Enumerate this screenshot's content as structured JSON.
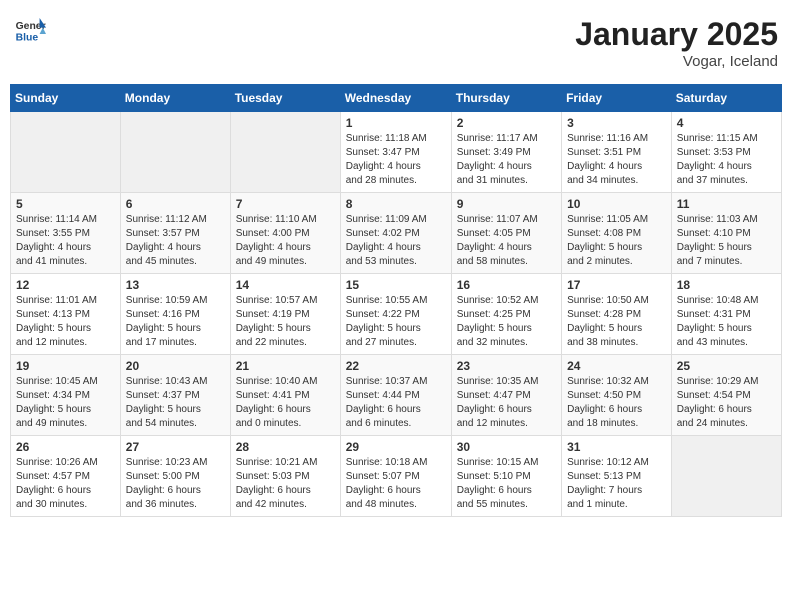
{
  "header": {
    "logo_general": "General",
    "logo_blue": "Blue",
    "title": "January 2025",
    "subtitle": "Vogar, Iceland"
  },
  "weekdays": [
    "Sunday",
    "Monday",
    "Tuesday",
    "Wednesday",
    "Thursday",
    "Friday",
    "Saturday"
  ],
  "weeks": [
    [
      {
        "day": "",
        "info": ""
      },
      {
        "day": "",
        "info": ""
      },
      {
        "day": "",
        "info": ""
      },
      {
        "day": "1",
        "info": "Sunrise: 11:18 AM\nSunset: 3:47 PM\nDaylight: 4 hours\nand 28 minutes."
      },
      {
        "day": "2",
        "info": "Sunrise: 11:17 AM\nSunset: 3:49 PM\nDaylight: 4 hours\nand 31 minutes."
      },
      {
        "day": "3",
        "info": "Sunrise: 11:16 AM\nSunset: 3:51 PM\nDaylight: 4 hours\nand 34 minutes."
      },
      {
        "day": "4",
        "info": "Sunrise: 11:15 AM\nSunset: 3:53 PM\nDaylight: 4 hours\nand 37 minutes."
      }
    ],
    [
      {
        "day": "5",
        "info": "Sunrise: 11:14 AM\nSunset: 3:55 PM\nDaylight: 4 hours\nand 41 minutes."
      },
      {
        "day": "6",
        "info": "Sunrise: 11:12 AM\nSunset: 3:57 PM\nDaylight: 4 hours\nand 45 minutes."
      },
      {
        "day": "7",
        "info": "Sunrise: 11:10 AM\nSunset: 4:00 PM\nDaylight: 4 hours\nand 49 minutes."
      },
      {
        "day": "8",
        "info": "Sunrise: 11:09 AM\nSunset: 4:02 PM\nDaylight: 4 hours\nand 53 minutes."
      },
      {
        "day": "9",
        "info": "Sunrise: 11:07 AM\nSunset: 4:05 PM\nDaylight: 4 hours\nand 58 minutes."
      },
      {
        "day": "10",
        "info": "Sunrise: 11:05 AM\nSunset: 4:08 PM\nDaylight: 5 hours\nand 2 minutes."
      },
      {
        "day": "11",
        "info": "Sunrise: 11:03 AM\nSunset: 4:10 PM\nDaylight: 5 hours\nand 7 minutes."
      }
    ],
    [
      {
        "day": "12",
        "info": "Sunrise: 11:01 AM\nSunset: 4:13 PM\nDaylight: 5 hours\nand 12 minutes."
      },
      {
        "day": "13",
        "info": "Sunrise: 10:59 AM\nSunset: 4:16 PM\nDaylight: 5 hours\nand 17 minutes."
      },
      {
        "day": "14",
        "info": "Sunrise: 10:57 AM\nSunset: 4:19 PM\nDaylight: 5 hours\nand 22 minutes."
      },
      {
        "day": "15",
        "info": "Sunrise: 10:55 AM\nSunset: 4:22 PM\nDaylight: 5 hours\nand 27 minutes."
      },
      {
        "day": "16",
        "info": "Sunrise: 10:52 AM\nSunset: 4:25 PM\nDaylight: 5 hours\nand 32 minutes."
      },
      {
        "day": "17",
        "info": "Sunrise: 10:50 AM\nSunset: 4:28 PM\nDaylight: 5 hours\nand 38 minutes."
      },
      {
        "day": "18",
        "info": "Sunrise: 10:48 AM\nSunset: 4:31 PM\nDaylight: 5 hours\nand 43 minutes."
      }
    ],
    [
      {
        "day": "19",
        "info": "Sunrise: 10:45 AM\nSunset: 4:34 PM\nDaylight: 5 hours\nand 49 minutes."
      },
      {
        "day": "20",
        "info": "Sunrise: 10:43 AM\nSunset: 4:37 PM\nDaylight: 5 hours\nand 54 minutes."
      },
      {
        "day": "21",
        "info": "Sunrise: 10:40 AM\nSunset: 4:41 PM\nDaylight: 6 hours\nand 0 minutes."
      },
      {
        "day": "22",
        "info": "Sunrise: 10:37 AM\nSunset: 4:44 PM\nDaylight: 6 hours\nand 6 minutes."
      },
      {
        "day": "23",
        "info": "Sunrise: 10:35 AM\nSunset: 4:47 PM\nDaylight: 6 hours\nand 12 minutes."
      },
      {
        "day": "24",
        "info": "Sunrise: 10:32 AM\nSunset: 4:50 PM\nDaylight: 6 hours\nand 18 minutes."
      },
      {
        "day": "25",
        "info": "Sunrise: 10:29 AM\nSunset: 4:54 PM\nDaylight: 6 hours\nand 24 minutes."
      }
    ],
    [
      {
        "day": "26",
        "info": "Sunrise: 10:26 AM\nSunset: 4:57 PM\nDaylight: 6 hours\nand 30 minutes."
      },
      {
        "day": "27",
        "info": "Sunrise: 10:23 AM\nSunset: 5:00 PM\nDaylight: 6 hours\nand 36 minutes."
      },
      {
        "day": "28",
        "info": "Sunrise: 10:21 AM\nSunset: 5:03 PM\nDaylight: 6 hours\nand 42 minutes."
      },
      {
        "day": "29",
        "info": "Sunrise: 10:18 AM\nSunset: 5:07 PM\nDaylight: 6 hours\nand 48 minutes."
      },
      {
        "day": "30",
        "info": "Sunrise: 10:15 AM\nSunset: 5:10 PM\nDaylight: 6 hours\nand 55 minutes."
      },
      {
        "day": "31",
        "info": "Sunrise: 10:12 AM\nSunset: 5:13 PM\nDaylight: 7 hours\nand 1 minute."
      },
      {
        "day": "",
        "info": ""
      }
    ]
  ]
}
